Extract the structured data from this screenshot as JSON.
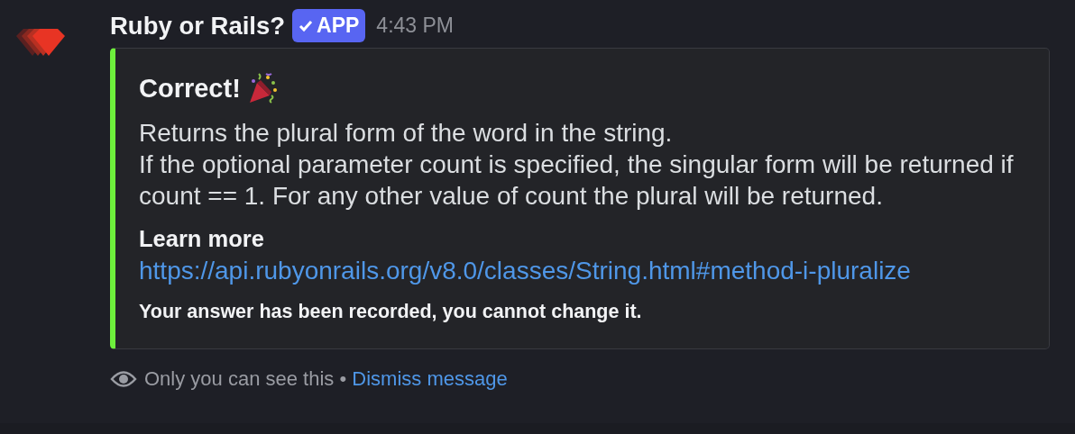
{
  "message": {
    "author": "Ruby or Rails?",
    "badge": {
      "label": "APP",
      "verified": true
    },
    "timestamp": "4:43 PM"
  },
  "embed": {
    "title": "Correct!",
    "title_emoji": true,
    "description": [
      "Returns the plural form of the word in the string.",
      "If the optional parameter count is specified, the singular form will be returned if count == 1. For any other value of count the plural will be returned."
    ],
    "fields": [
      {
        "name": "Learn more",
        "value": "https://api.rubyonrails.org/v8.0/classes/String.html#method-i-pluralize"
      }
    ],
    "footer": "Your answer has been recorded, you cannot change it."
  },
  "ephemeral": {
    "note": "Only you can see this •",
    "action": "Dismiss message"
  }
}
